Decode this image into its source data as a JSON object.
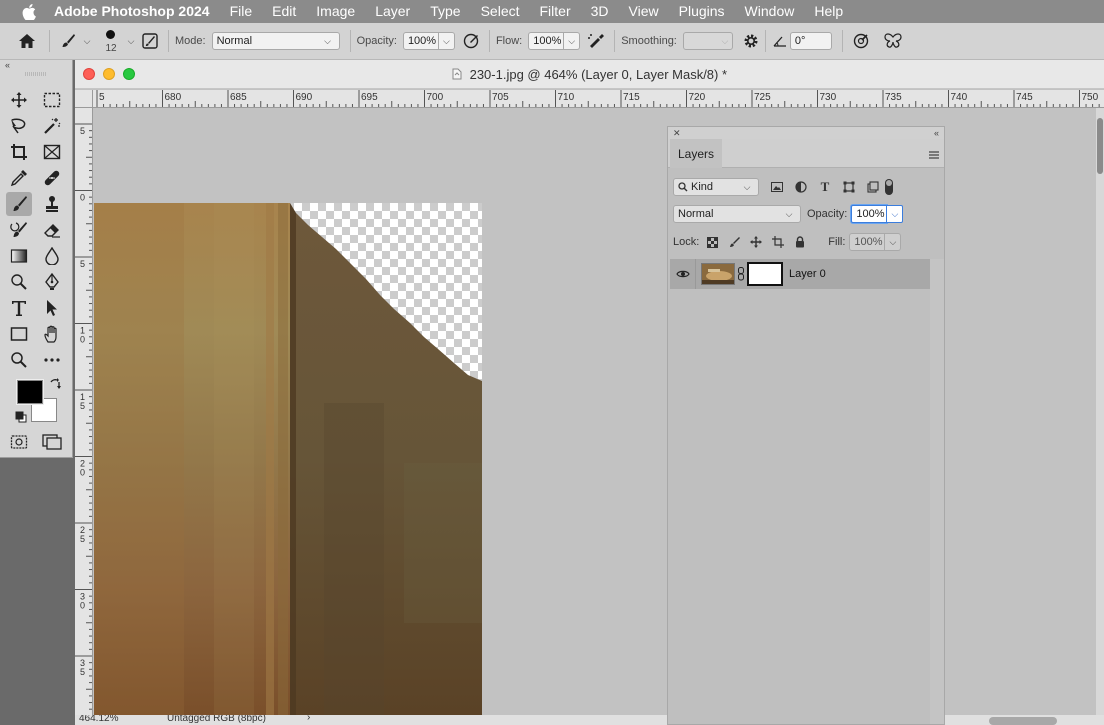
{
  "menubar": {
    "app": "Adobe Photoshop 2024",
    "items": [
      "File",
      "Edit",
      "Image",
      "Layer",
      "Type",
      "Select",
      "Filter",
      "3D",
      "View",
      "Plugins",
      "Window",
      "Help"
    ]
  },
  "options": {
    "brush_size": "12",
    "mode_label": "Mode:",
    "mode_value": "Normal",
    "opacity_label": "Opacity:",
    "opacity_value": "100%",
    "flow_label": "Flow:",
    "flow_value": "100%",
    "smoothing_label": "Smoothing:",
    "smoothing_value": "",
    "angle_value": "0°"
  },
  "document": {
    "title": "230-1.jpg @ 464% (Layer 0, Layer Mask/8) *",
    "zoom": "464.12%",
    "color_profile": "Untagged RGB (8bpc)",
    "h_ruler_labels": [
      "5",
      "680",
      "685",
      "690",
      "695",
      "700",
      "705",
      "710",
      "715",
      "720",
      "725",
      "730",
      "735",
      "740",
      "745",
      "750"
    ],
    "v_ruler_labels": [
      "5",
      "0",
      "5",
      "1\n0",
      "1\n5",
      "2\n0",
      "2\n5",
      "3\n0",
      "3\n5"
    ]
  },
  "layers_panel": {
    "title": "Layers",
    "filter_kind": "Kind",
    "blend_mode": "Normal",
    "opacity_label": "Opacity:",
    "opacity_value": "100%",
    "lock_label": "Lock:",
    "fill_label": "Fill:",
    "fill_value": "100%",
    "layers": [
      {
        "name": "Layer 0",
        "visible": true,
        "has_mask": true
      }
    ]
  },
  "colors": {
    "foreground": "#000000",
    "background": "#ffffff"
  }
}
